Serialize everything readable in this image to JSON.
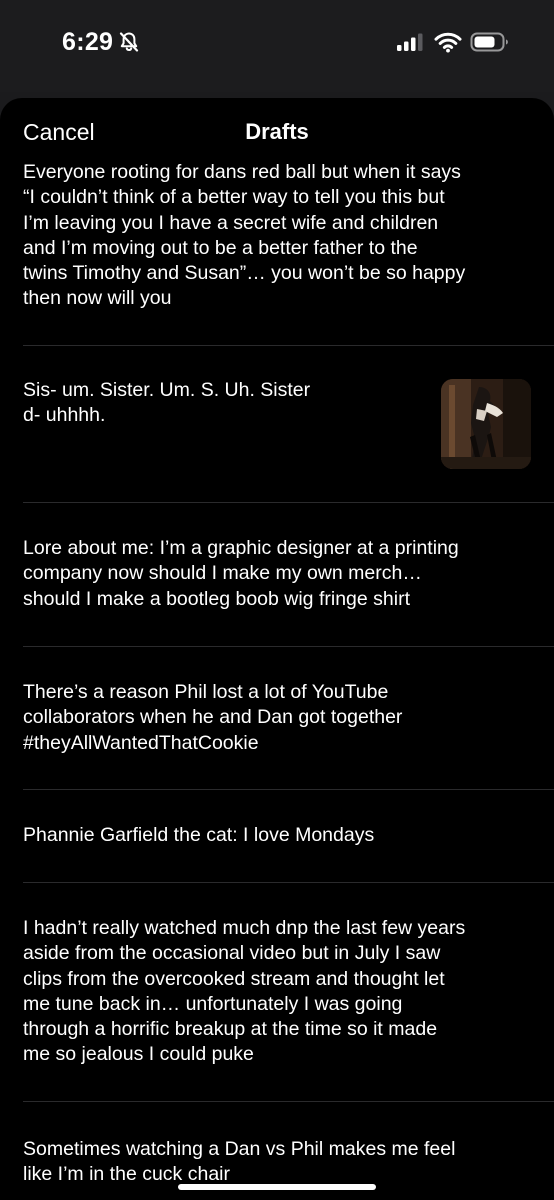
{
  "status_bar": {
    "time": "6:29",
    "icons": [
      "bell-slash-icon",
      "signal-icon",
      "wifi-icon",
      "battery-icon"
    ]
  },
  "nav": {
    "cancel_label": "Cancel",
    "title": "Drafts"
  },
  "drafts": [
    {
      "text": "Everyone rooting for dans red ball but when it says\n“I couldn’t think of a better way to tell you this but\nI’m leaving you I have a secret wife and children\nand I’m moving out to be a better father to the\ntwins Timothy and Susan”… you won’t be so happy\nthen now will you"
    },
    {
      "text": "Sis- um. Sister. Um. S. Uh. Sister\nd- uhhhh.",
      "has_image": true
    },
    {
      "text": "Lore about me: I’m a graphic designer at a printing\ncompany now should I make my own merch…\nshould I make a bootleg boob wig fringe shirt"
    },
    {
      "text": "There’s a reason Phil lost a lot of YouTube\ncollaborators when he and Dan got together\n#theyAllWantedThatCookie"
    },
    {
      "text": "Phannie Garfield the cat: I love Mondays"
    },
    {
      "text": "I hadn’t really watched much dnp the last few years\naside from the occasional video but in July I saw\nclips from the overcooked stream and thought let\nme tune back in… unfortunately I was going\nthrough a horrific breakup at the time so it made\nme so jealous I could puke"
    },
    {
      "text": "Sometimes watching a Dan vs Phil makes me feel\nlike I’m in the cuck chair"
    }
  ],
  "colors": {
    "background": "#000000",
    "status_bar_bg": "#1c1c1e",
    "text": "#ffffff",
    "divider": "#2a2a2c"
  }
}
